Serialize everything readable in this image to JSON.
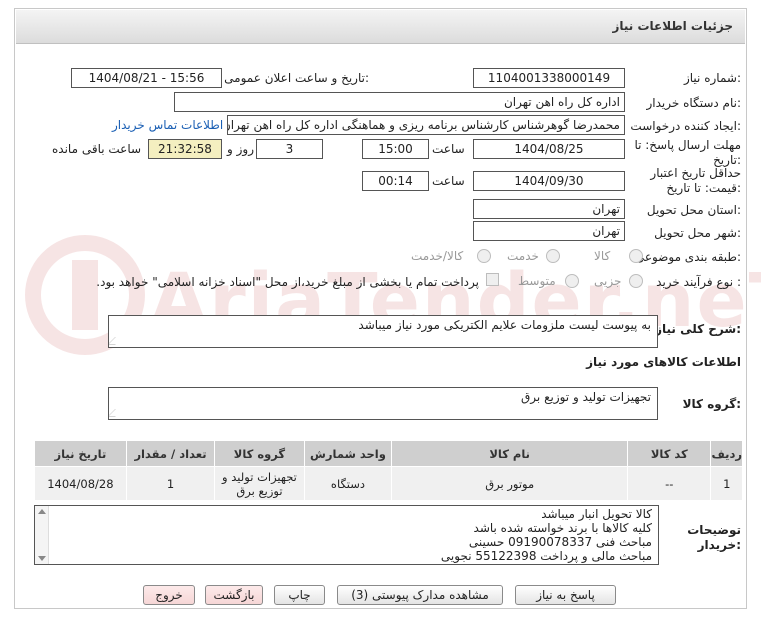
{
  "header": {
    "title": "جزئیات اطلاعات نیاز"
  },
  "watermark": {
    "text": "AriaTender.neT"
  },
  "fields": {
    "need_number_label": "شماره نیاز:",
    "need_number": "1104001338000149",
    "announce_label": "تاریخ و ساعت اعلان عمومی:",
    "announce_value": "1404/08/21 - 15:56",
    "buyer_label": "نام دستگاه خریدار:",
    "buyer_value": "اداره کل راه اهن تهران",
    "creator_label": "ایجاد کننده درخواست:",
    "creator_value": "محمدرضا گوهرشناس کارشناس برنامه ریزی و هماهنگی اداره کل راه اهن تهران",
    "contact_link": "اطلاعات تماس خریدار",
    "deadline_label_1": "مهلت ارسال پاسخ: تا",
    "deadline_label_2": "تاریخ:",
    "deadline_date": "1404/08/25",
    "time_label": "ساعت",
    "deadline_time": "15:00",
    "days_value": "3",
    "days_label": "روز و",
    "remaining_value": "21:32:58",
    "remaining_label": "ساعت باقی مانده",
    "validity_label_1": "حداقل تاریخ اعتبار",
    "validity_label_2": "قیمت: تا تاریخ:",
    "validity_date": "1404/09/30",
    "validity_time": "00:14",
    "province_label": "استان محل تحویل:",
    "province_value": "تهران",
    "city_label": "شهر محل تحویل:",
    "city_value": "تهران",
    "category_label": "طبقه بندی موضوعی:",
    "category_options": [
      "کالا",
      "خدمت",
      "کالا/خدمت"
    ],
    "process_label": "نوع فرآیند خرید :",
    "process_options": [
      "جزیی",
      "متوسط"
    ],
    "payment_note": "پرداخت تمام یا بخشی از مبلغ خرید،از محل \"اسناد خزانه اسلامی\" خواهد بود.",
    "description_label": "شرح کلی نیاز:",
    "description_value": "به پیوست لیست ملزومات علایم الکتریکی مورد نیاز میباشد",
    "goods_section_title": "اطلاعات کالاهای مورد نیاز",
    "goods_group_label": "گروه کالا:",
    "goods_group_value": "تجهیزات تولید و توزیع برق",
    "buyer_notes_label_1": "توضیحات",
    "buyer_notes_label_2": "خریدار:",
    "buyer_notes_lines": [
      "کالا تحویل انبار میباشد",
      "کلیه کالاها با برند خواسته شده باشد",
      "مباحث فنی 09190078337 حسینی",
      "مباحث مالی و پرداخت 55122398 نجویی"
    ]
  },
  "table": {
    "headers": [
      "ردیف",
      "کد کالا",
      "نام کالا",
      "واحد شمارش",
      "گروه کالا",
      "تعداد / مقدار",
      "تاریخ نیاز"
    ],
    "rows": [
      {
        "row": "1",
        "code": "--",
        "name": "موتور برق",
        "unit": "دستگاه",
        "group": "تجهیزات تولید و توزیع برق",
        "qty": "1",
        "date": "1404/08/28"
      }
    ]
  },
  "buttons": {
    "reply": "پاسخ به نیاز",
    "attachments": "مشاهده مدارک پیوستی (3)",
    "print": "چاپ",
    "back": "بازگشت",
    "exit": "خروج"
  }
}
